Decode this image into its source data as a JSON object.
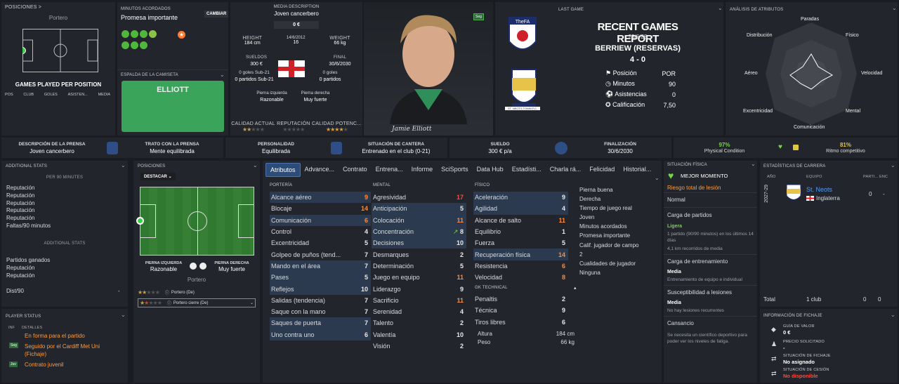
{
  "positions": {
    "header": "Posiciones >",
    "label": "Portero",
    "chart_title": "GAMES PLAYED PER POSITION",
    "columns": [
      "POS",
      "CLUB",
      "GOLES",
      "ASISTEN...",
      "MEDIA"
    ]
  },
  "minutes": {
    "header": "Minutos acordados",
    "value": "Promesa importante",
    "button": "CAMBIAR"
  },
  "shirt": {
    "header": "Espalda de la camiseta",
    "name": "ELLIOTT"
  },
  "media": {
    "header": "Media description",
    "value": "Joven cancerbero",
    "price": "0 €",
    "height_label": "Height",
    "height": "184 cm",
    "dob": "14/6/2012",
    "age": "16",
    "weight_label": "Weight",
    "weight": "66 kg",
    "wage_label": "Sueldos",
    "wage": "300 €",
    "final_label": "Final",
    "final": "30/6/2030",
    "goals_u21_label": "0 goles Sub-21",
    "goals_label": "0 goles",
    "apps_u21": "0 partidos Sub-21",
    "apps": "0 partidos",
    "left_foot_label": "Pierna izquierda",
    "right_foot_label": "Pierna derecha",
    "left_foot": "Razonable",
    "right_foot": "Muy fuerte",
    "ability_label": "Calidad actual",
    "rep_label": "Reputación",
    "potential_label": "Calidad potenc..."
  },
  "player": {
    "signature": "Jamie Elliott",
    "badge": "Seg"
  },
  "last_game": {
    "header": "Last game",
    "title": "RECENT GAMES REPORT",
    "date": "25/6/28",
    "opponent": "BERRIEW (RESERVAS)",
    "score": "4 - 0",
    "items": [
      {
        "label": "Posición",
        "value": "POR"
      },
      {
        "label": "Minutos",
        "value": "90"
      },
      {
        "label": "Asistencias",
        "value": "0"
      },
      {
        "label": "Calificación",
        "value": "7,50"
      }
    ],
    "logo_a": "TheFA",
    "logo_b": "ST. NEOTS TOWN F.C."
  },
  "attr_analysis": {
    "header": "Análisis de atributos",
    "labels": [
      "Paradas",
      "Físico",
      "Velocidad",
      "Mental",
      "Comunicación",
      "Excentricidad",
      "Aéreo",
      "Distribución"
    ]
  },
  "infobar": [
    {
      "label": "Descripción de la prensa",
      "value": "Joven cancerbero"
    },
    {
      "label": "Trato con la prensa",
      "value": "Mente equilibrada"
    },
    {
      "label": "Personalidad",
      "value": "Equilibrada"
    },
    {
      "label": "Situación de cantera",
      "value": "Entrenado en el club (0-21)"
    },
    {
      "label": "Sueldo",
      "value": "300 € p/a"
    },
    {
      "label": "Finalización",
      "value": "30/6/2030"
    },
    {
      "label": "97%",
      "value": "Physical Condition"
    },
    {
      "label": "81%",
      "value": "Ritmo competitivo"
    }
  ],
  "additional": {
    "header": "Additional stats",
    "sub1": "Per 90 minutes",
    "items1": [
      "Reputación",
      "Reputación",
      "Reputación",
      "Reputación",
      "Reputación",
      "Faltas/90 minutos"
    ],
    "sub2": "Additional stats",
    "items2": [
      "Partidos ganados",
      "Reputación",
      "Reputación"
    ],
    "dist": "Dist/90",
    "dist_val": "-"
  },
  "player_status": {
    "header": "Player status",
    "col1": "INF",
    "col2": "Detalles",
    "items": [
      {
        "tag": "",
        "text": "En forma para el partido"
      },
      {
        "tag": "Seg",
        "text": "Seguido por el Cardiff Met Uni (Fichaje)"
      },
      {
        "tag": "Juv",
        "text": "Contrato juvenil"
      }
    ]
  },
  "pos_panel": {
    "header": "Posiciones",
    "select": "DESTACAR",
    "left_label": "Pierna izquierda",
    "left": "Razonable",
    "right_label": "Pierna derecha",
    "right": "Muy fuerte",
    "pos": "Portero",
    "role1": "Portero (De)",
    "role2": "Portero cierre (De)"
  },
  "tabs": [
    "Atributos",
    "Advance...",
    "Contrato",
    "Entrena...",
    "Informe",
    "SciSports",
    "Data Hub",
    "Estadísti...",
    "Charla rá...",
    "Felicidad",
    "Historial..."
  ],
  "goalkeeping": {
    "header": "Portería",
    "rows": [
      [
        "Alcance aéreo",
        "9"
      ],
      [
        "Blocaje",
        "14"
      ],
      [
        "Comunicación",
        "6"
      ],
      [
        "Control",
        "4"
      ],
      [
        "Excentricidad",
        "5"
      ],
      [
        "Golpeo de puños (tend...",
        "7"
      ],
      [
        "Mando en el área",
        "7"
      ],
      [
        "Pases",
        "5"
      ],
      [
        "Reflejos",
        "10"
      ],
      [
        "Salidas (tendencia)",
        "7"
      ],
      [
        "Saque con la mano",
        "7"
      ],
      [
        "Saques de puerta",
        "7"
      ],
      [
        "Uno contra uno",
        "6"
      ]
    ]
  },
  "mental": {
    "header": "Mental",
    "rows": [
      [
        "Agresividad",
        "17"
      ],
      [
        "Anticipación",
        "5"
      ],
      [
        "Colocación",
        "11"
      ],
      [
        "Concentración",
        "8"
      ],
      [
        "Decisiones",
        "10"
      ],
      [
        "Desmarques",
        "2"
      ],
      [
        "Determinación",
        "5"
      ],
      [
        "Juego en equipo",
        "11"
      ],
      [
        "Liderazgo",
        "9"
      ],
      [
        "Sacrificio",
        "11"
      ],
      [
        "Serenidad",
        "4"
      ],
      [
        "Talento",
        "2"
      ],
      [
        "Valentía",
        "10"
      ],
      [
        "Visión",
        "2"
      ]
    ]
  },
  "physical": {
    "header": "Físico",
    "rows": [
      [
        "Aceleración",
        "9"
      ],
      [
        "Agilidad",
        "4"
      ],
      [
        "Alcance de salto",
        "11"
      ],
      [
        "Equilibrio",
        "1"
      ],
      [
        "Fuerza",
        "5"
      ],
      [
        "Recuperación física",
        "14"
      ],
      [
        "Resistencia",
        "6"
      ],
      [
        "Velocidad",
        "8"
      ]
    ],
    "tech_header": "GK Technical",
    "tech": [
      [
        "Penaltis",
        "2"
      ],
      [
        "Técnica",
        "9"
      ],
      [
        "Tiros libres",
        "6"
      ]
    ],
    "height_label": "Altura",
    "height": "184 cm",
    "weight_label": "Peso",
    "weight": "66 kg"
  },
  "extra": [
    "Pierna buena",
    "Derecha",
    "Tiempo de juego real",
    "Joven",
    "Minutos acordados",
    "Promesa importante",
    "Calif. jugador de campo",
    "2",
    "Cualidades de jugador",
    "Ninguna"
  ],
  "physical_status": {
    "header": "Situación física",
    "best": "MEJOR MOMENTO",
    "risk": "Riesgo total de lesión",
    "risk_val": "Normal",
    "load": "Carga de partidos",
    "load_val": "Ligera",
    "load_desc": "1 partido (90/90 minutos) en los últimos 14 días",
    "load_km": "4,1 km recorridos de media",
    "train": "Carga de entrenamiento",
    "train_val": "Media",
    "train_desc": "Entrenamiento de equipo e individual",
    "inj": "Susceptibilidad a lesiones",
    "inj_val": "Media",
    "inj_desc": "No hay lesiones recurrentes",
    "fatigue": "Cansancio",
    "fatigue_desc": "Se necesita un científico deportivo para poder ver los niveles de fatiga."
  },
  "career": {
    "header": "Estadísticas de carrera",
    "cols": [
      "Año",
      "Equipo",
      "Parti...",
      "Enc"
    ],
    "year": "2027-29",
    "team": "St. Neots",
    "country": "Inglaterra",
    "apps": "0",
    "goals": "-",
    "total": "Total",
    "clubs": "1 club",
    "t_apps": "0",
    "t_goals": "0"
  },
  "transfer": {
    "header": "Información de fichaje",
    "items": [
      {
        "label": "Guía de valor",
        "value": "0 €"
      },
      {
        "label": "Precio solicitado",
        "value": "-"
      },
      {
        "label": "Situación de fichaje",
        "value": "No asignado"
      },
      {
        "label": "Situación de cesión",
        "value": "No disponible"
      }
    ]
  }
}
